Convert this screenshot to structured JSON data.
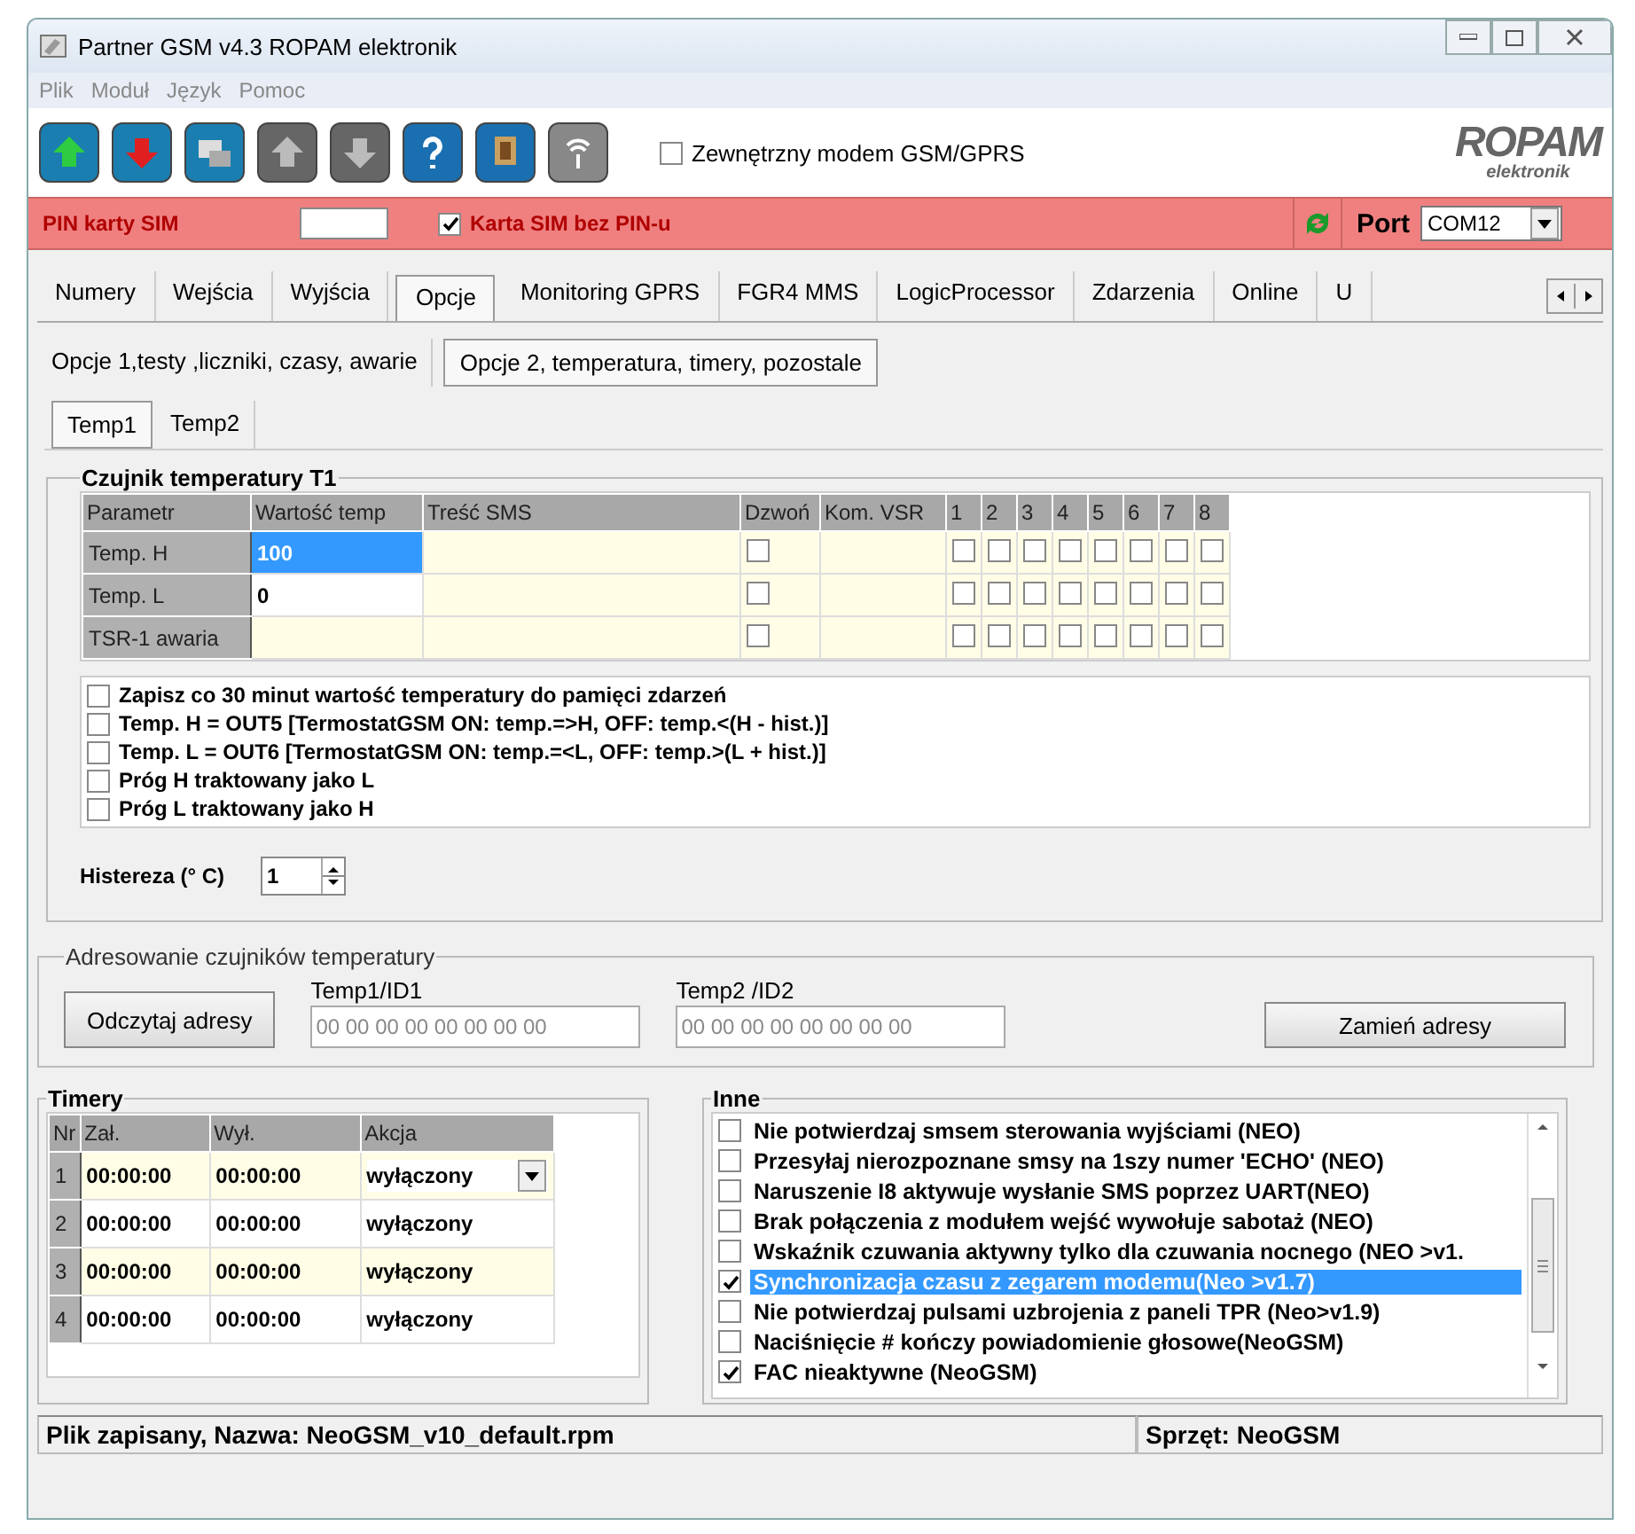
{
  "window": {
    "title": "Partner GSM v4.3 ROPAM elektronik"
  },
  "menu": [
    "Plik",
    "Moduł",
    "Język",
    "Pomoc"
  ],
  "external_modem": {
    "label": "Zewnętrzny modem GSM/GPRS",
    "checked": false
  },
  "logo": {
    "name": "ROPAM",
    "tagline": "elektronik"
  },
  "pin_bar": {
    "label": "PIN karty SIM",
    "no_pin": {
      "label": "Karta SIM bez PIN-u",
      "checked": true
    },
    "port_label": "Port",
    "port": "COM12"
  },
  "tabs": [
    {
      "label": "Numery",
      "selected": false
    },
    {
      "label": "Wejścia",
      "selected": false
    },
    {
      "label": "Wyjścia",
      "selected": false
    },
    {
      "label": "Opcje",
      "selected": true
    },
    {
      "label": "Monitoring GPRS",
      "selected": false
    },
    {
      "label": "FGR4 MMS",
      "selected": false
    },
    {
      "label": "LogicProcessor",
      "selected": false
    },
    {
      "label": "Zdarzenia",
      "selected": false
    },
    {
      "label": "Online",
      "selected": false
    },
    {
      "label": "U",
      "selected": false
    }
  ],
  "subtabs": [
    {
      "label": "Opcje 1,testy ,liczniki, czasy, awarie",
      "selected": false
    },
    {
      "label": "Opcje 2, temperatura, timery, pozostale",
      "selected": true
    }
  ],
  "temp_tabs": [
    {
      "label": "Temp1",
      "selected": true
    },
    {
      "label": "Temp2",
      "selected": false
    }
  ],
  "sensor": {
    "title": "Czujnik temperatury T1",
    "columns": [
      "Parametr",
      "Wartość temp",
      "Treść SMS",
      "Dzwoń",
      "Kom. VSR",
      "1",
      "2",
      "3",
      "4",
      "5",
      "6",
      "7",
      "8"
    ],
    "rows": [
      {
        "param": "Temp. H",
        "value": "100",
        "selected": true,
        "ring": false,
        "outputs": [
          false,
          false,
          false,
          false,
          false,
          false,
          false,
          false
        ]
      },
      {
        "param": "Temp. L",
        "value": "0",
        "selected": false,
        "ring": false,
        "outputs": [
          false,
          false,
          false,
          false,
          false,
          false,
          false,
          false
        ]
      },
      {
        "param": "TSR-1 awaria",
        "selected": false,
        "ring": false,
        "outputs": [
          false,
          false,
          false,
          false,
          false,
          false,
          false,
          false
        ]
      }
    ],
    "options": [
      {
        "label": "Zapisz co 30 minut wartość temperatury do pamięci zdarzeń",
        "checked": false
      },
      {
        "label": "Temp. H = OUT5 [TermostatGSM ON: temp.=>H, OFF: temp.<(H - hist.)]",
        "checked": false
      },
      {
        "label": "Temp. L = OUT6 [TermostatGSM ON: temp.=<L, OFF: temp.>(L + hist.)]",
        "checked": false
      },
      {
        "label": "Próg H traktowany jako L",
        "checked": false
      },
      {
        "label": "Próg L traktowany jako H",
        "checked": false
      }
    ],
    "hysteresis": {
      "label": "Histereza (° C)",
      "value": "1"
    }
  },
  "addressing": {
    "title": "Adresowanie czujników temperatury",
    "read_button": "Odczytaj adresy",
    "fields": [
      {
        "label": "Temp1/ID1",
        "placeholder": "00 00 00 00 00 00 00 00"
      },
      {
        "label": "Temp2 /ID2",
        "placeholder": "00 00 00 00 00 00 00 00"
      }
    ],
    "swap_button": "Zamień adresy"
  },
  "timers": {
    "title": "Timery",
    "columns": [
      "Nr",
      "Zał.",
      "Wył.",
      "Akcja"
    ],
    "rows": [
      {
        "nr": "1",
        "on": "00:00:00",
        "off": "00:00:00",
        "action": "wyłączony",
        "editing": true
      },
      {
        "nr": "2",
        "on": "00:00:00",
        "off": "00:00:00",
        "action": "wyłączony",
        "editing": false
      },
      {
        "nr": "3",
        "on": "00:00:00",
        "off": "00:00:00",
        "action": "wyłączony",
        "editing": false
      },
      {
        "nr": "4",
        "on": "00:00:00",
        "off": "00:00:00",
        "action": "wyłączony",
        "editing": false
      }
    ]
  },
  "other": {
    "title": "Inne",
    "items": [
      {
        "label": "Nie potwierdzaj smsem sterowania wyjściami (NEO)",
        "checked": false,
        "selected": false
      },
      {
        "label": "Przesyłaj nierozpoznane smsy na 1szy numer 'ECHO' (NEO)",
        "checked": false,
        "selected": false
      },
      {
        "label": "Naruszenie I8 aktywuje wysłanie SMS poprzez UART(NEO)",
        "checked": false,
        "selected": false
      },
      {
        "label": "Brak połączenia z modułem wejść  wywołuje sabotaż (NEO)",
        "checked": false,
        "selected": false
      },
      {
        "label": "Wskaźnik czuwania aktywny tylko dla czuwania nocnego (NEO >v1.",
        "checked": false,
        "selected": false
      },
      {
        "label": "Synchronizacja czasu z zegarem modemu(Neo >v1.7)",
        "checked": true,
        "selected": true
      },
      {
        "label": "Nie potwierdzaj pulsami uzbrojenia z paneli TPR (Neo>v1.9)",
        "checked": false,
        "selected": false
      },
      {
        "label": "Naciśnięcie # kończy powiadomienie głosowe(NeoGSM)",
        "checked": false,
        "selected": false
      },
      {
        "label": "FAC nieaktywne (NeoGSM)",
        "checked": true,
        "selected": false
      }
    ]
  },
  "status_bar": {
    "file": "Plik zapisany, Nazwa: NeoGSM_v10_default.rpm",
    "hardware": "Sprzęt: NeoGSM"
  }
}
